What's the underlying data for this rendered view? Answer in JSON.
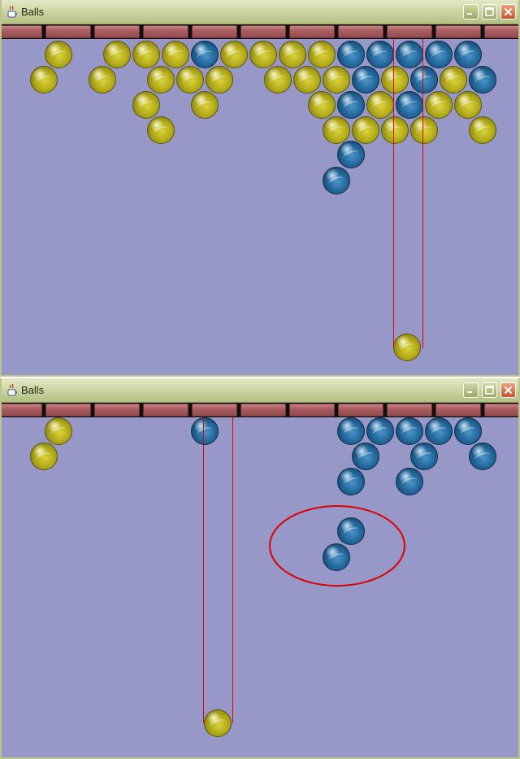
{
  "windows": [
    {
      "title": "Balls",
      "controls": [
        "minimize-icon",
        "maximize-icon",
        "close-icon"
      ]
    },
    {
      "title": "Balls",
      "controls": [
        "minimize-icon",
        "maximize-icon",
        "close-icon"
      ]
    }
  ],
  "colors": {
    "background": "#9797c8",
    "yellow_ball": "#c9c124",
    "blue_ball": "#23689c",
    "aim_line": "#dd0000",
    "highlight_ellipse": "#dd0000",
    "brick": "#a85d60"
  }
}
